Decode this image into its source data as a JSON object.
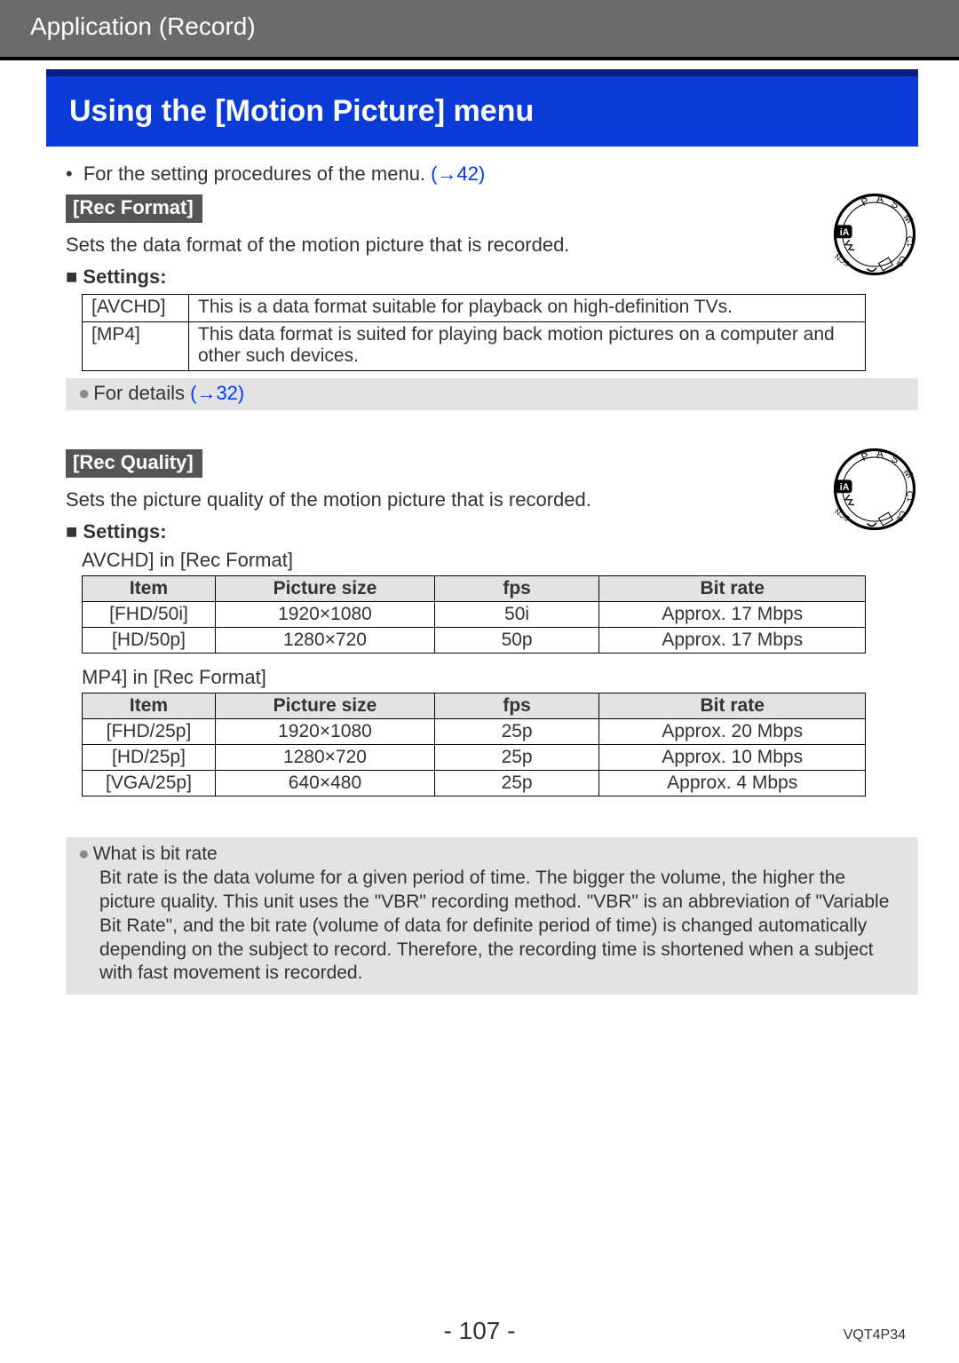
{
  "breadcrumb": "Application (Record)",
  "title": "Using the [Motion Picture] menu",
  "intro": {
    "text": "For the setting procedures of the menu. ",
    "link": "(→42)"
  },
  "rec_format": {
    "label": "[Rec Format]",
    "desc": "Sets the data format of the motion picture that is recorded.",
    "settings_label": "Settings:",
    "rows": [
      {
        "key": "[AVCHD]",
        "val": "This is a data format suitable for playback on high-definition TVs."
      },
      {
        "key": "[MP4]",
        "val": "This data format is suited for playing back motion pictures on a computer and other such devices."
      }
    ],
    "details": {
      "text": "For details ",
      "link": "(→32)"
    }
  },
  "rec_quality": {
    "label": "[Rec Quality]",
    "desc": "Sets the picture quality of the motion picture that is recorded.",
    "settings_label": "Settings:",
    "cap_avchd": "AVCHD] in [Rec Format]",
    "cap_mp4": "MP4] in [Rec Format]",
    "headers": {
      "item": "Item",
      "size": "Picture size",
      "fps": "fps",
      "bitrate": "Bit rate"
    },
    "avchd_rows": [
      {
        "item": "[FHD/50i]",
        "size": "1920×1080",
        "fps": "50i",
        "bitrate": "Approx. 17 Mbps"
      },
      {
        "item": "[HD/50p]",
        "size": "1280×720",
        "fps": "50p",
        "bitrate": "Approx. 17 Mbps"
      }
    ],
    "mp4_rows": [
      {
        "item": "[FHD/25p]",
        "size": "1920×1080",
        "fps": "25p",
        "bitrate": "Approx. 20 Mbps"
      },
      {
        "item": "[HD/25p]",
        "size": "1280×720",
        "fps": "25p",
        "bitrate": "Approx. 10 Mbps"
      },
      {
        "item": "[VGA/25p]",
        "size": "640×480",
        "fps": "25p",
        "bitrate": "Approx. 4 Mbps"
      }
    ]
  },
  "bitrate_info": {
    "title": "What is bit rate",
    "body": "Bit rate is the data volume for a given period of time. The bigger the volume, the higher the picture quality. This unit uses the \"VBR\" recording method. \"VBR\" is an abbreviation of \"Variable Bit Rate\", and the bit rate (volume of data for definite period of time) is changed automatically depending on the subject to record. Therefore, the recording time is shortened when a subject with fast movement is recorded."
  },
  "footer": {
    "page": "- 107 -",
    "docid": "VQT4P34"
  },
  "dial_labels": {
    "p": "P",
    "a": "A",
    "s": "S",
    "m": "M",
    "c1": "C1",
    "c2": "C2",
    "scn": "SCN"
  }
}
